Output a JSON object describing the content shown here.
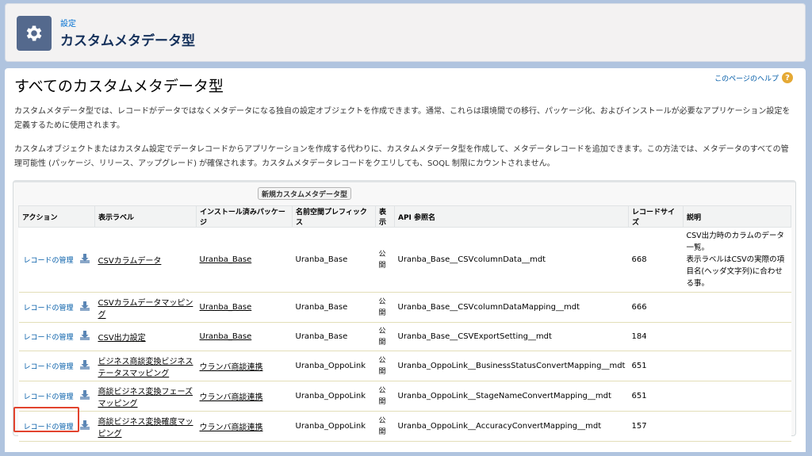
{
  "header": {
    "breadcrumb": "設定",
    "title": "カスタムメタデータ型",
    "icon": "gear-icon"
  },
  "main": {
    "page_title": "すべてのカスタムメタデータ型",
    "help_link": "このページのヘルプ",
    "description1": "カスタムメタデータ型では、レコードがデータではなくメタデータになる独自の設定オブジェクトを作成できます。通常、これらは環境間での移行、パッケージ化、およびインストールが必要なアプリケーション設定を定義するために使用されます。",
    "description2": "カスタムオブジェクトまたはカスタム設定でデータレコードからアプリケーションを作成する代わりに、カスタムメタデータ型を作成して、メタデータレコードを追加できます。この方法では、メタデータのすべての管理可能性 (パッケージ、リリース、アップグレード) が確保されます。カスタムメタデータレコードをクエリしても、SOQL 制限にカウントされません。",
    "new_button": "新規カスタムメタデータ型"
  },
  "table": {
    "headers": [
      "アクション",
      "表示ラベル",
      "インストール済みパッケージ",
      "名前空間プレフィックス",
      "表示",
      "API 参照名",
      "レコードサイズ",
      "説明"
    ],
    "rows": [
      {
        "action": "レコードの管理",
        "label": "CSVカラムデータ",
        "package": "Uranba_Base",
        "prefix": "Uranba_Base",
        "visibility": "公開",
        "api_name": "Uranba_Base__CSVcolumnData__mdt",
        "size": "668",
        "description": "CSV出力時のカラムのデータ一覧。\n表示ラベルはCSVの実際の項目名(ヘッダ文字列)に合わせる事。"
      },
      {
        "action": "レコードの管理",
        "label": "CSVカラムデータマッピング",
        "package": "Uranba_Base",
        "prefix": "Uranba_Base",
        "visibility": "公開",
        "api_name": "Uranba_Base__CSVcolumnDataMapping__mdt",
        "size": "666",
        "description": ""
      },
      {
        "action": "レコードの管理",
        "label": "CSV出力設定",
        "package": "Uranba_Base",
        "prefix": "Uranba_Base",
        "visibility": "公開",
        "api_name": "Uranba_Base__CSVExportSetting__mdt",
        "size": "184",
        "description": ""
      },
      {
        "action": "レコードの管理",
        "label": "ビジネス商談変換ビジネステータスマッピング",
        "package": "ウランバ商談連携",
        "prefix": "Uranba_OppoLink",
        "visibility": "公開",
        "api_name": "Uranba_OppoLink__BusinessStatusConvertMapping__mdt",
        "size": "651",
        "description": ""
      },
      {
        "action": "レコードの管理",
        "label": "商談ビジネス変換フェーズマッピング",
        "package": "ウランバ商談連携",
        "prefix": "Uranba_OppoLink",
        "visibility": "公開",
        "api_name": "Uranba_OppoLink__StageNameConvertMapping__mdt",
        "size": "651",
        "description": ""
      },
      {
        "action": "レコードの管理",
        "label": "商談ビジネス変換確度マッピング",
        "package": "ウランバ商談連携",
        "prefix": "Uranba_OppoLink",
        "visibility": "公開",
        "api_name": "Uranba_OppoLink__AccuracyConvertMapping__mdt",
        "size": "157",
        "description": ""
      }
    ]
  },
  "colors": {
    "link": "#015ba7",
    "highlight": "#e2432e",
    "header_icon_bg": "#54698d"
  }
}
